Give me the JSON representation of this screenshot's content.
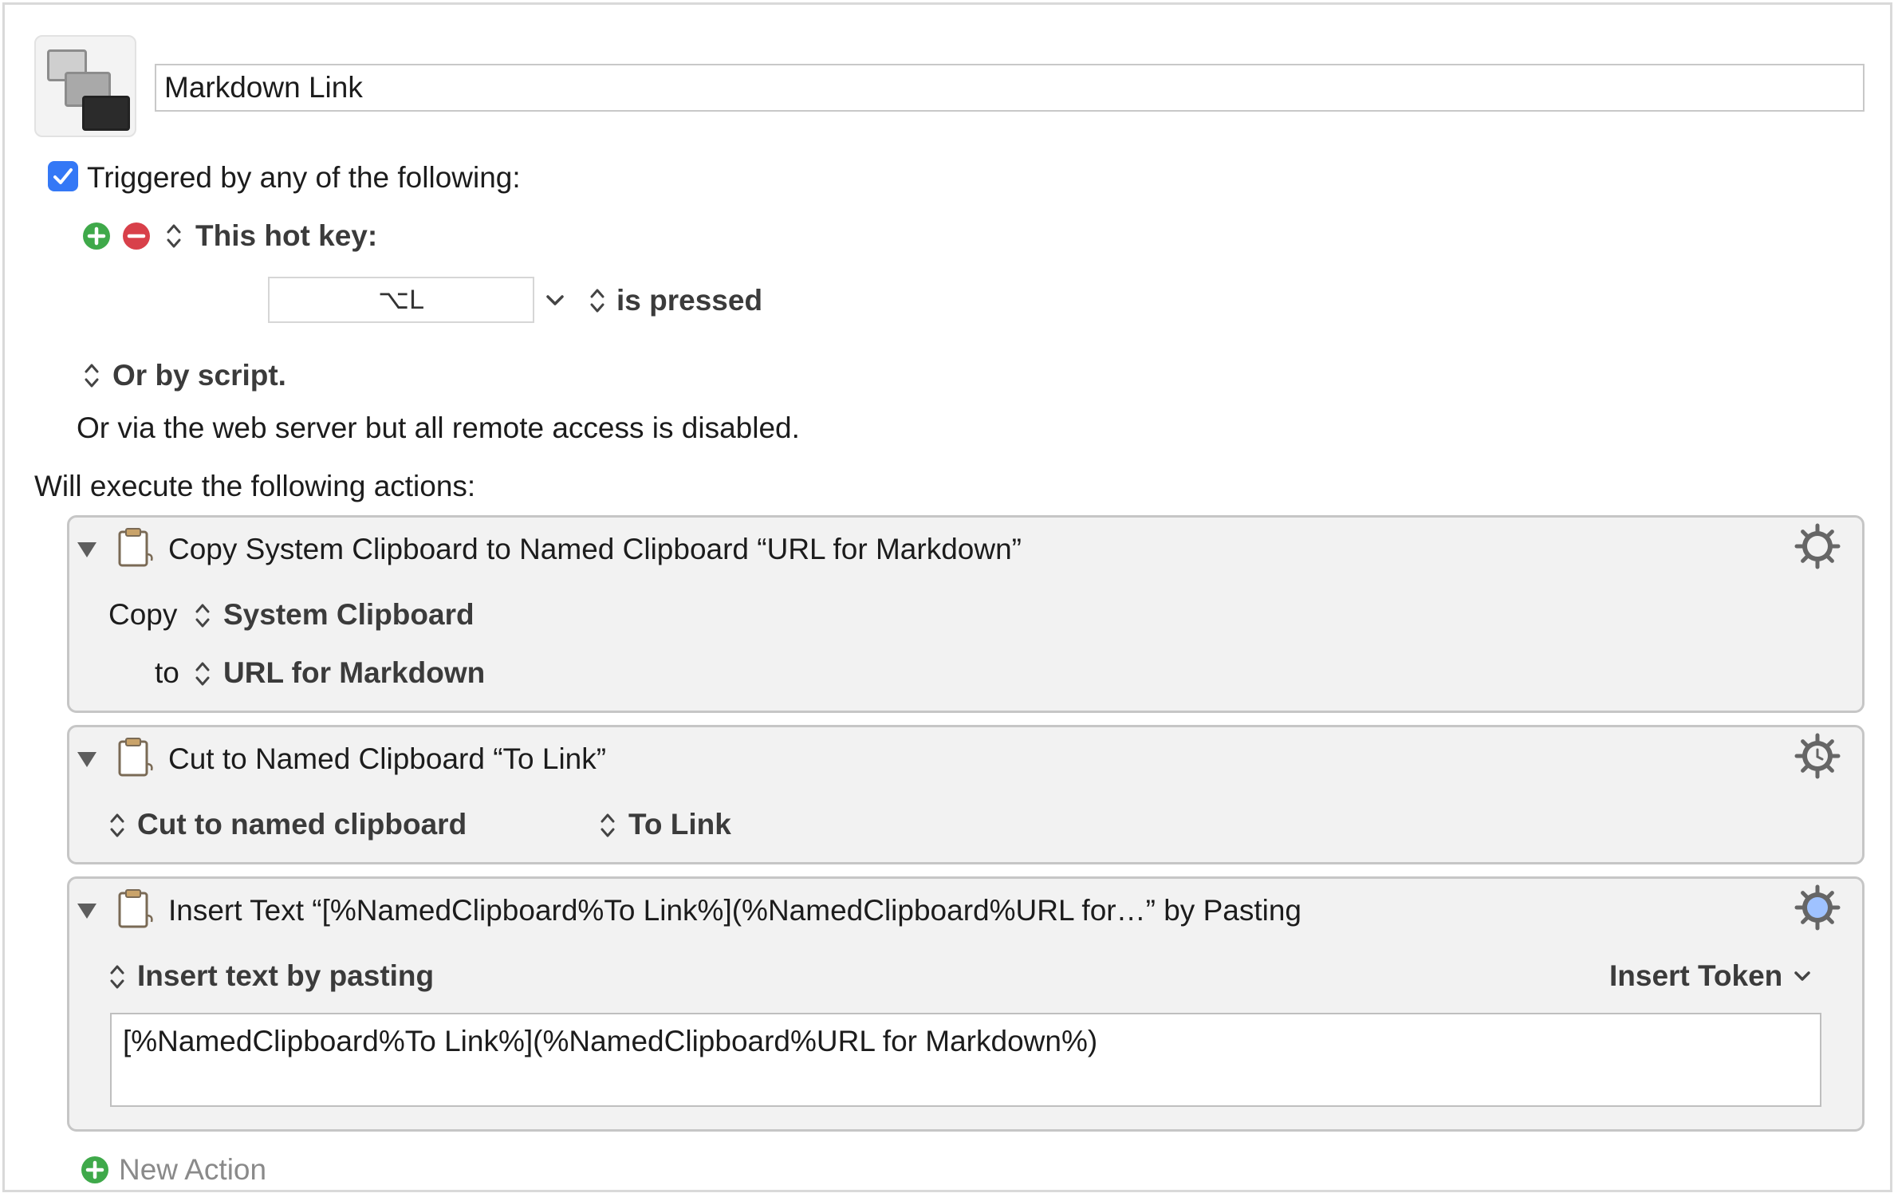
{
  "macro": {
    "name": "Markdown Link",
    "icon": "macro-windows-icon"
  },
  "triggers": {
    "header": "Triggered by any of the following:",
    "header_checked": true,
    "hotkey_label": "This hot key:",
    "hotkey_value": "⌥L",
    "hotkey_condition": "is pressed",
    "script_label": "Or by script.",
    "web_server_text": "Or via the web server but all remote access is disabled."
  },
  "actions_header": "Will execute the following actions:",
  "actions": [
    {
      "title": "Copy System Clipboard to Named Clipboard “URL for Markdown”",
      "copy_label": "Copy",
      "source": "System Clipboard",
      "to_label": "to",
      "destination": "URL for Markdown"
    },
    {
      "title": "Cut to Named Clipboard “To Link”",
      "mode": "Cut to named clipboard",
      "clipboard": "To Link"
    },
    {
      "title": "Insert Text “[%NamedClipboard%To Link%](%NamedClipboard%URL for…” by Pasting",
      "mode": "Insert text by pasting",
      "insert_token_label": "Insert Token",
      "text": "[%NamedClipboard%To Link%](%NamedClipboard%URL for Markdown%)"
    }
  ],
  "new_action_label": "New Action",
  "colors": {
    "accent_blue": "#3478f6",
    "add_green": "#3fa94a",
    "remove_red": "#d8404a",
    "action_bg": "#f2f2f2"
  }
}
